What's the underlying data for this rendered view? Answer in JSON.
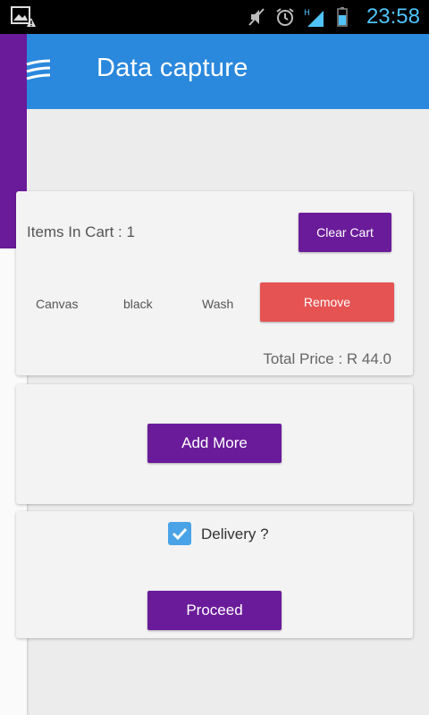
{
  "status_bar": {
    "time": "23:58",
    "icons": [
      "image-warning-icon",
      "mute-icon",
      "alarm-icon",
      "signal-h-icon",
      "battery-icon"
    ]
  },
  "app_bar": {
    "title": "Data capture",
    "menu_icon": "hamburger-icon",
    "color": "#2a88dd"
  },
  "cart": {
    "items_label": "Items In Cart : 1",
    "clear_button": "Clear Cart",
    "rows": [
      {
        "material": "Canvas",
        "color": "black",
        "service": "Wash",
        "remove_label": "Remove"
      }
    ],
    "total": "Total Price : R 44.0"
  },
  "add_more": {
    "label": "Add More"
  },
  "delivery": {
    "label": "Delivery ?",
    "checked": true,
    "proceed_label": "Proceed"
  },
  "colors": {
    "accent": "#6a1b9a",
    "remove": "#e55352",
    "checkbox": "#4aa3e6"
  }
}
